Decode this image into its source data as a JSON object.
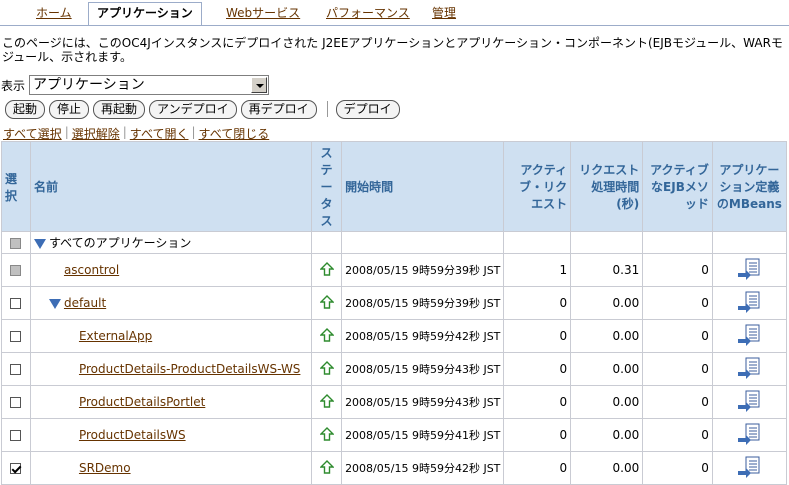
{
  "tabs": [
    {
      "label": "ホーム",
      "active": false
    },
    {
      "label": "アプリケーション",
      "active": true
    },
    {
      "label": "Webサービス",
      "active": false
    },
    {
      "label": "パフォーマンス",
      "active": false
    },
    {
      "label": "管理",
      "active": false
    }
  ],
  "description": "このページには、このOC4Jインスタンスにデプロイされた J2EEアプリケーションとアプリケーション・コンポーネント(EJBモジュール、WARモジュール、示されます。",
  "view": {
    "label": "表示",
    "selected": "アプリケーション"
  },
  "buttons": {
    "start": "起動",
    "stop": "停止",
    "restart": "再起動",
    "undeploy": "アンデプロイ",
    "redeploy": "再デプロイ",
    "deploy": "デプロイ"
  },
  "links": {
    "select_all": "すべて選択",
    "deselect": "選択解除",
    "expand_all": "すべて開く",
    "collapse_all": "すべて閉じる"
  },
  "columns": {
    "select": "選択",
    "name": "名前",
    "status": "ステータス",
    "start_time": "開始時間",
    "active_requests": "アクティブ・リクエスト",
    "request_time": "リクエスト処理時間(秒)",
    "active_ejb": "アクティブなEJBメソッド",
    "mbeans": "アプリケーション定義のMBeans"
  },
  "rows": [
    {
      "name": "すべてのアプリケーション",
      "level": 0,
      "expanded": true,
      "link": false,
      "checkbox": "disabled",
      "status": "",
      "start_time": "",
      "active_requests": "",
      "request_time": "",
      "active_ejb": "",
      "mbean": false
    },
    {
      "name": "ascontrol",
      "level": 1,
      "expanded": false,
      "link": true,
      "checkbox": "disabled",
      "status": "up",
      "start_time": "2008/05/15 9時59分39秒 JST",
      "active_requests": "1",
      "request_time": "0.31",
      "active_ejb": "0",
      "mbean": true
    },
    {
      "name": "default",
      "level": 1,
      "expanded": true,
      "link": true,
      "checkbox": "unchecked",
      "status": "up",
      "start_time": "2008/05/15 9時59分39秒 JST",
      "active_requests": "0",
      "request_time": "0.00",
      "active_ejb": "0",
      "mbean": true
    },
    {
      "name": "ExternalApp",
      "level": 2,
      "expanded": false,
      "link": true,
      "checkbox": "unchecked",
      "status": "up",
      "start_time": "2008/05/15 9時59分42秒 JST",
      "active_requests": "0",
      "request_time": "0.00",
      "active_ejb": "0",
      "mbean": true
    },
    {
      "name": "ProductDetails-ProductDetailsWS-WS",
      "level": 2,
      "expanded": false,
      "link": true,
      "checkbox": "unchecked",
      "status": "up",
      "start_time": "2008/05/15 9時59分43秒 JST",
      "active_requests": "0",
      "request_time": "0.00",
      "active_ejb": "0",
      "mbean": true
    },
    {
      "name": "ProductDetailsPortlet",
      "level": 2,
      "expanded": false,
      "link": true,
      "checkbox": "unchecked",
      "status": "up",
      "start_time": "2008/05/15 9時59分43秒 JST",
      "active_requests": "0",
      "request_time": "0.00",
      "active_ejb": "0",
      "mbean": true
    },
    {
      "name": "ProductDetailsWS",
      "level": 2,
      "expanded": false,
      "link": true,
      "checkbox": "unchecked",
      "status": "up",
      "start_time": "2008/05/15 9時59分41秒 JST",
      "active_requests": "0",
      "request_time": "0.00",
      "active_ejb": "0",
      "mbean": true
    },
    {
      "name": "SRDemo",
      "level": 2,
      "expanded": false,
      "link": true,
      "checkbox": "checked",
      "status": "up",
      "start_time": "2008/05/15 9時59分42秒 JST",
      "active_requests": "0",
      "request_time": "0.00",
      "active_ejb": "0",
      "mbean": true
    }
  ],
  "colors": {
    "header_bg": "#cfe0f1",
    "header_text": "#336699",
    "link": "#663300",
    "status_up": "#2e8b2e",
    "tree_triangle": "#3d6db5"
  }
}
